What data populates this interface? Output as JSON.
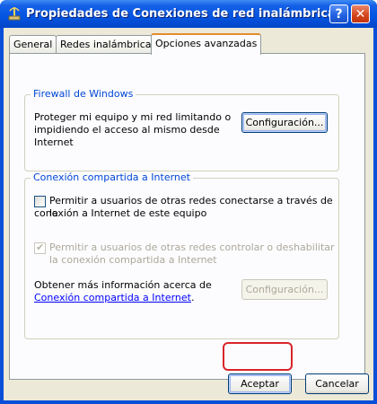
{
  "window": {
    "title": "Propiedades de Conexiones de red inalámbricas",
    "help_label": "?",
    "close_label": "✕"
  },
  "tabs": [
    {
      "label": "General"
    },
    {
      "label": "Redes inalámbricas"
    },
    {
      "label": "Opciones avanzadas",
      "active": true
    }
  ],
  "firewall": {
    "legend": "Firewall de Windows",
    "description_line1": "Proteger mi equipo y mi red limitando o",
    "description_line2": "impidiendo el acceso al mismo desde",
    "description_line3": "Internet",
    "config_button": "Configuración..."
  },
  "ics": {
    "legend": "Conexión compartida a Internet",
    "allow_connect_line1": "Permitir a usuarios de otras redes conectarse a través de la",
    "allow_connect_line2": "conexión a Internet de este equipo",
    "allow_connect_checked": false,
    "allow_control_line1": "Permitir a usuarios de otras redes controlar o deshabilitar",
    "allow_control_line2": "la conexión compartida a Internet",
    "allow_control_checked": true,
    "info_text": "Obtener más información acerca de",
    "info_link": "Conexión compartida a Internet",
    "info_period": ".",
    "config_button": "Configuración..."
  },
  "footer": {
    "ok_label": "Aceptar",
    "cancel_label": "Cancelar"
  },
  "colors": {
    "titlebar": "#0454e1",
    "dialog_bg": "#ece9d8",
    "group_legend": "#0046d5",
    "highlight": "#d9252a"
  }
}
